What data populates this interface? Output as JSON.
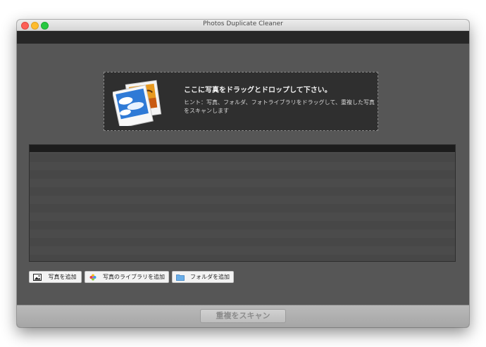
{
  "window": {
    "title": "Photos Duplicate Cleaner"
  },
  "dropzone": {
    "title": "ここに写真をドラッグとドロップして下さい。",
    "hint": "ヒント：写真、フォルダ、フォトライブラリをドラッグして、重複した写真をスキャンします",
    "icon": "photos-icon"
  },
  "buttons": {
    "add_photos": "写真を追加",
    "add_library": "写真のライブラリを追加",
    "add_folder": "フォルダを追加",
    "scan": "重複をスキャン"
  }
}
